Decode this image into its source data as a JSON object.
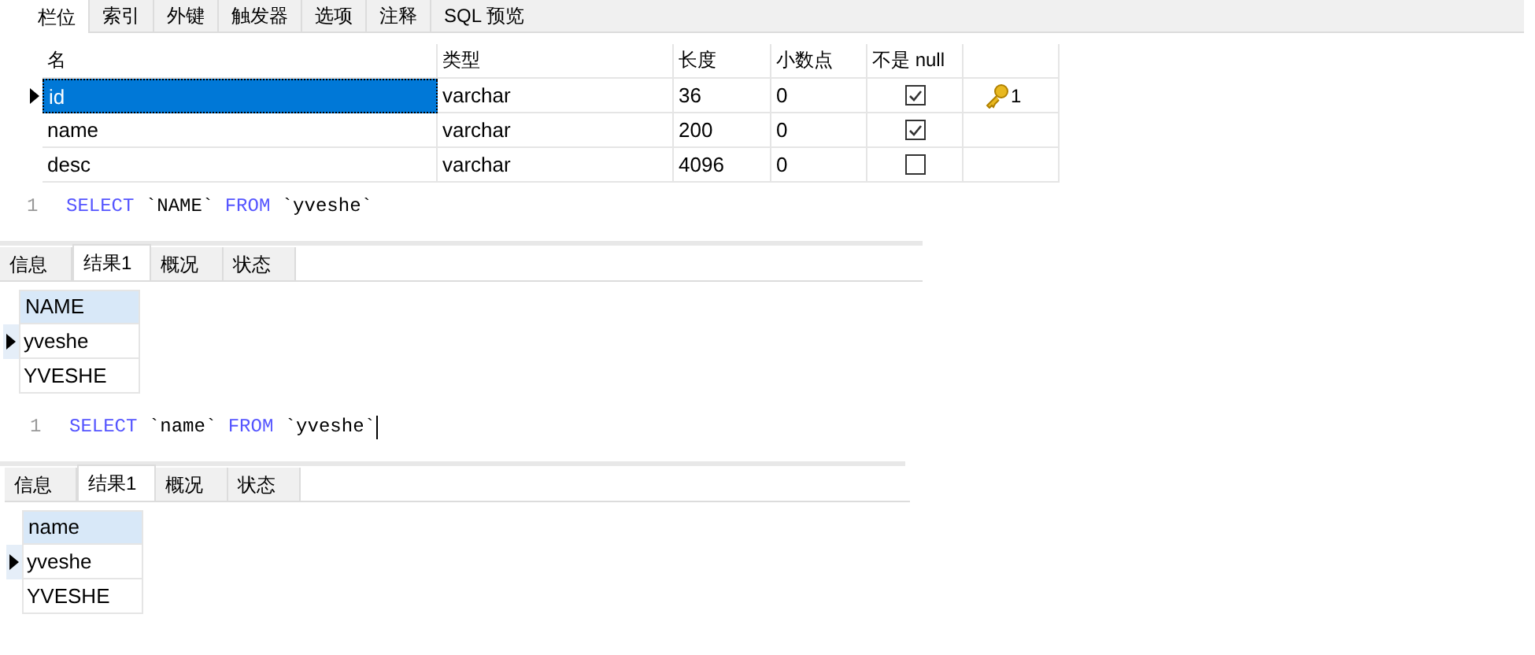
{
  "design_tabs": [
    {
      "label": "栏位",
      "selected": true
    },
    {
      "label": "索引",
      "selected": false
    },
    {
      "label": "外键",
      "selected": false
    },
    {
      "label": "触发器",
      "selected": false
    },
    {
      "label": "选项",
      "selected": false
    },
    {
      "label": "注释",
      "selected": false
    },
    {
      "label": "SQL 预览",
      "selected": false
    }
  ],
  "fields": {
    "columns": [
      "名",
      "类型",
      "长度",
      "小数点",
      "不是 null"
    ],
    "rows": [
      {
        "name": "id",
        "type": "varchar",
        "length": "36",
        "decimals": "0",
        "not_null": true,
        "key_order": "1",
        "current": true,
        "selected": true
      },
      {
        "name": "name",
        "type": "varchar",
        "length": "200",
        "decimals": "0",
        "not_null": true,
        "current": false,
        "selected": false
      },
      {
        "name": "desc",
        "type": "varchar",
        "length": "4096",
        "decimals": "0",
        "not_null": false,
        "current": false,
        "selected": false
      }
    ]
  },
  "queries": [
    {
      "line_number": "1",
      "cursor": false,
      "sql": [
        {
          "kind": "keyword",
          "text": "SELECT"
        },
        {
          "kind": "identifier",
          "text": "`NAME`"
        },
        {
          "kind": "keyword",
          "text": "FROM"
        },
        {
          "kind": "identifier",
          "text": "`yveshe`"
        }
      ],
      "result_tabs": [
        {
          "label": "信息",
          "selected": false
        },
        {
          "label": "结果1",
          "selected": true
        },
        {
          "label": "概况",
          "selected": false
        },
        {
          "label": "状态",
          "selected": false
        }
      ],
      "result": {
        "column": "NAME",
        "rows": [
          {
            "value": "yveshe",
            "current": true
          },
          {
            "value": "YVESHE",
            "current": false
          }
        ]
      }
    },
    {
      "line_number": "1",
      "cursor": true,
      "sql": [
        {
          "kind": "keyword",
          "text": "SELECT"
        },
        {
          "kind": "identifier",
          "text": "`name`"
        },
        {
          "kind": "keyword",
          "text": "FROM"
        },
        {
          "kind": "identifier",
          "text": "`yveshe`"
        }
      ],
      "result_tabs": [
        {
          "label": "信息",
          "selected": false
        },
        {
          "label": "结果1",
          "selected": true
        },
        {
          "label": "概况",
          "selected": false
        },
        {
          "label": "状态",
          "selected": false
        }
      ],
      "result": {
        "column": "name",
        "rows": [
          {
            "value": "yveshe",
            "current": true
          },
          {
            "value": "YVESHE",
            "current": false
          }
        ]
      }
    }
  ]
}
